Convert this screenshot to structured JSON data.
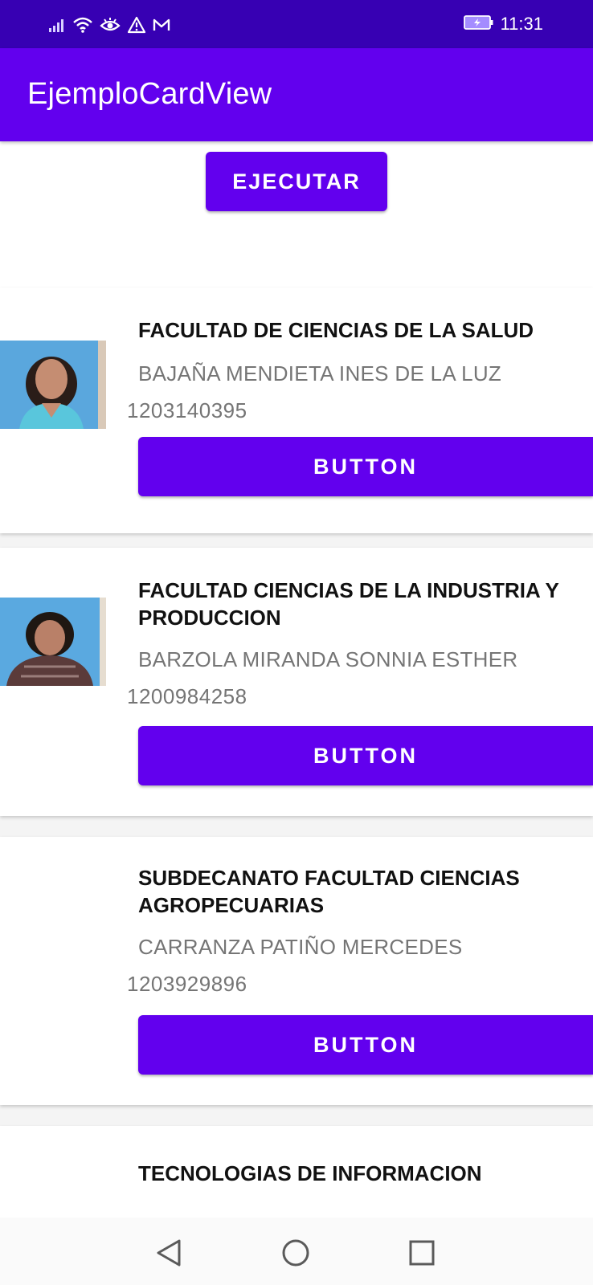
{
  "status_bar": {
    "time": "11:31",
    "left_icons": [
      "signal-icon",
      "wifi-icon",
      "eye-icon",
      "warning-icon",
      "mail-icon"
    ],
    "right_icons": [
      "battery-charging-icon"
    ]
  },
  "app_bar": {
    "title": "EjemploCardView"
  },
  "execute_button": {
    "label": "EJECUTAR"
  },
  "cards": [
    {
      "faculty": "FACULTAD DE CIENCIAS DE LA SALUD",
      "name": "BAJAÑA MENDIETA INES DE LA LUZ",
      "id_number": "1203140395",
      "button_label": "BUTTON",
      "has_photo": true
    },
    {
      "faculty": "FACULTAD CIENCIAS DE LA INDUSTRIA Y PRODUCCION",
      "name": "BARZOLA MIRANDA SONNIA ESTHER",
      "id_number": "1200984258",
      "button_label": "BUTTON",
      "has_photo": true
    },
    {
      "faculty": "SUBDECANATO FACULTAD CIENCIAS AGROPECUARIAS",
      "name": "CARRANZA PATIÑO MERCEDES",
      "id_number": "1203929896",
      "button_label": "BUTTON",
      "has_photo": false
    },
    {
      "faculty": "TECNOLOGIAS DE INFORMACION"
    }
  ],
  "nav_bar": {
    "icons": [
      "back-icon",
      "home-icon",
      "recents-icon"
    ]
  },
  "colors": {
    "primary": "#6200ee",
    "primary_dark": "#3700b3",
    "secondary_text": "#757575"
  }
}
